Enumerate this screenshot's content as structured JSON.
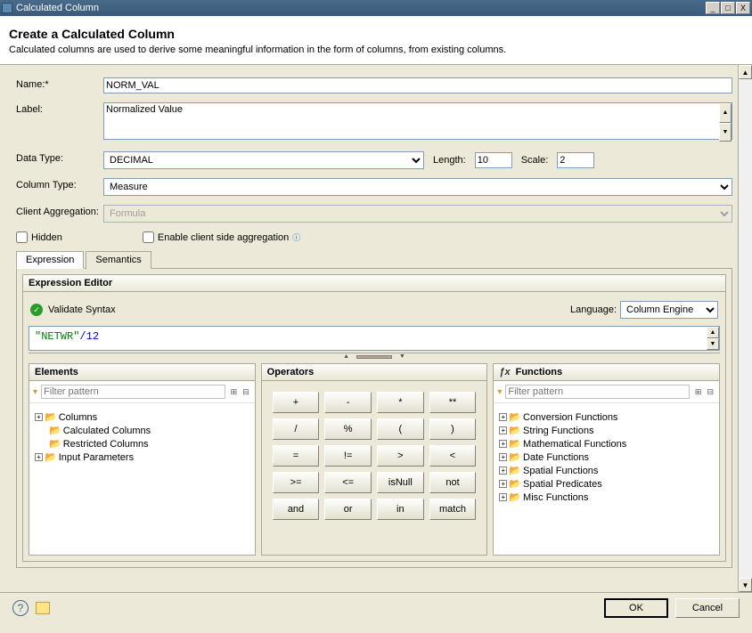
{
  "window": {
    "title": "Calculated Column",
    "minimize": "_",
    "maximize": "□",
    "close": "X"
  },
  "header": {
    "title": "Create a Calculated Column",
    "subtitle": "Calculated columns are used to derive some meaningful information in the form of columns, from existing columns."
  },
  "form": {
    "name_label": "Name:*",
    "name_value": "NORM_VAL",
    "label_label": "Label:",
    "label_value": "Normalized Value",
    "datatype_label": "Data Type:",
    "datatype_value": "DECIMAL",
    "length_label": "Length:",
    "length_value": "10",
    "scale_label": "Scale:",
    "scale_value": "2",
    "coltype_label": "Column Type:",
    "coltype_value": "Measure",
    "clientagg_label": "Client Aggregation:",
    "clientagg_value": "Formula",
    "hidden_label": "Hidden",
    "enable_client_label": "Enable client side aggregation"
  },
  "tabs": {
    "expression": "Expression",
    "semantics": "Semantics"
  },
  "editor": {
    "title": "Expression Editor",
    "validate": "Validate Syntax",
    "language_label": "Language:",
    "language_value": "Column Engine",
    "expression_quoted": "\"NETWR\"",
    "expression_rest": "/12"
  },
  "elements": {
    "title": "Elements",
    "filter_placeholder": "Filter pattern",
    "items": [
      "Columns",
      "Calculated Columns",
      "Restricted Columns",
      "Input Parameters"
    ]
  },
  "operators": {
    "title": "Operators",
    "buttons": [
      "+",
      "-",
      "*",
      "**",
      "/",
      "%",
      "(",
      ")",
      "=",
      "!=",
      ">",
      "<",
      ">=",
      "<=",
      "isNull",
      "not",
      "and",
      "or",
      "in",
      "match"
    ]
  },
  "functions": {
    "title": "Functions",
    "filter_placeholder": "Filter pattern",
    "items": [
      "Conversion Functions",
      "String Functions",
      "Mathematical Functions",
      "Date Functions",
      "Spatial Functions",
      "Spatial Predicates",
      "Misc Functions"
    ]
  },
  "footer": {
    "ok": "OK",
    "cancel": "Cancel"
  }
}
